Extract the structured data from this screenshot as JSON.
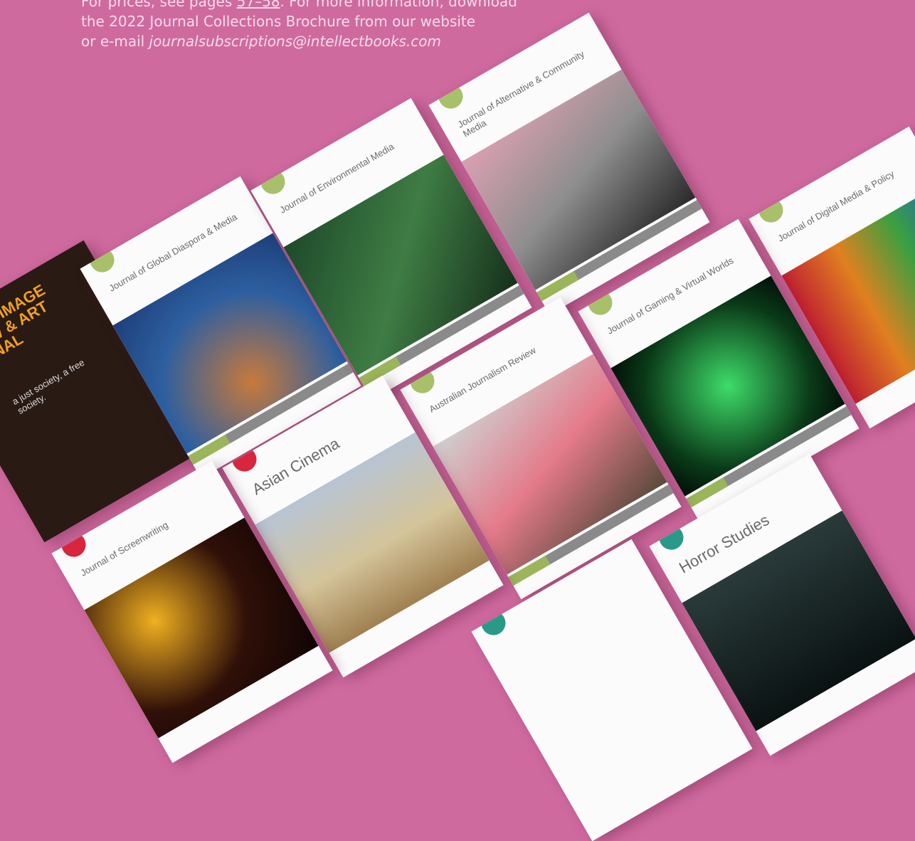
{
  "intro": {
    "line1_pre": "For prices, see pages ",
    "line1_link": "57–58",
    "line1_post": ". For more information, download",
    "line2": "the 2022 Journal Collections Brochure from our website",
    "line3_pre": "or e-mail ",
    "line3_email": "journalsubscriptions@intellectbooks.com"
  },
  "covers": [
    {
      "title": "Journal of Global Diaspora & Media"
    },
    {
      "title": "Journal of Environmental Media"
    },
    {
      "title": "Journal of Alternative & Community Media"
    },
    {
      "title": "Journal of Digital Media & Policy"
    },
    {
      "title": "Journal of Gaming & Virtual Worlds"
    },
    {
      "title": "Australian Journalism Review"
    },
    {
      "title": "Asian Cinema"
    },
    {
      "title": "Journal of Screenwriting"
    },
    {
      "title": "Horror Studies"
    },
    {
      "title": "MOVING IMAGE REVIEW & ART JOURNAL",
      "sub": "a just society, a free society."
    }
  ],
  "colors": {
    "background": "#cf6a9f",
    "green_dot": "#a8c06a",
    "red_dot": "#d7263d",
    "teal_dot": "#2a9a88"
  }
}
